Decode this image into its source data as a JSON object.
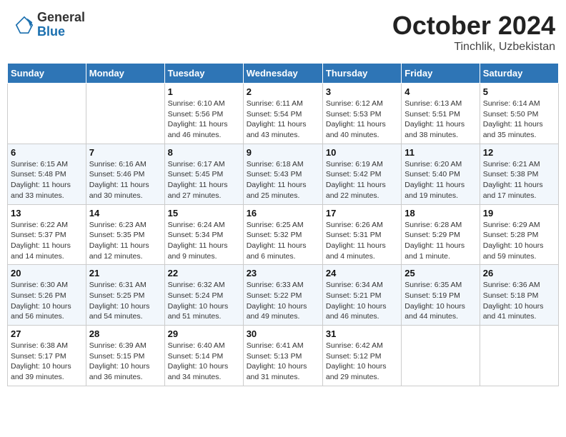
{
  "header": {
    "logo": {
      "general": "General",
      "blue": "Blue"
    },
    "title": "October 2024",
    "subtitle": "Tinchlik, Uzbekistan"
  },
  "weekdays": [
    "Sunday",
    "Monday",
    "Tuesday",
    "Wednesday",
    "Thursday",
    "Friday",
    "Saturday"
  ],
  "weeks": [
    [
      null,
      null,
      {
        "day": "1",
        "sunrise": "6:10 AM",
        "sunset": "5:56 PM",
        "daylight": "11 hours and 46 minutes."
      },
      {
        "day": "2",
        "sunrise": "6:11 AM",
        "sunset": "5:54 PM",
        "daylight": "11 hours and 43 minutes."
      },
      {
        "day": "3",
        "sunrise": "6:12 AM",
        "sunset": "5:53 PM",
        "daylight": "11 hours and 40 minutes."
      },
      {
        "day": "4",
        "sunrise": "6:13 AM",
        "sunset": "5:51 PM",
        "daylight": "11 hours and 38 minutes."
      },
      {
        "day": "5",
        "sunrise": "6:14 AM",
        "sunset": "5:50 PM",
        "daylight": "11 hours and 35 minutes."
      }
    ],
    [
      {
        "day": "6",
        "sunrise": "6:15 AM",
        "sunset": "5:48 PM",
        "daylight": "11 hours and 33 minutes."
      },
      {
        "day": "7",
        "sunrise": "6:16 AM",
        "sunset": "5:46 PM",
        "daylight": "11 hours and 30 minutes."
      },
      {
        "day": "8",
        "sunrise": "6:17 AM",
        "sunset": "5:45 PM",
        "daylight": "11 hours and 27 minutes."
      },
      {
        "day": "9",
        "sunrise": "6:18 AM",
        "sunset": "5:43 PM",
        "daylight": "11 hours and 25 minutes."
      },
      {
        "day": "10",
        "sunrise": "6:19 AM",
        "sunset": "5:42 PM",
        "daylight": "11 hours and 22 minutes."
      },
      {
        "day": "11",
        "sunrise": "6:20 AM",
        "sunset": "5:40 PM",
        "daylight": "11 hours and 19 minutes."
      },
      {
        "day": "12",
        "sunrise": "6:21 AM",
        "sunset": "5:38 PM",
        "daylight": "11 hours and 17 minutes."
      }
    ],
    [
      {
        "day": "13",
        "sunrise": "6:22 AM",
        "sunset": "5:37 PM",
        "daylight": "11 hours and 14 minutes."
      },
      {
        "day": "14",
        "sunrise": "6:23 AM",
        "sunset": "5:35 PM",
        "daylight": "11 hours and 12 minutes."
      },
      {
        "day": "15",
        "sunrise": "6:24 AM",
        "sunset": "5:34 PM",
        "daylight": "11 hours and 9 minutes."
      },
      {
        "day": "16",
        "sunrise": "6:25 AM",
        "sunset": "5:32 PM",
        "daylight": "11 hours and 6 minutes."
      },
      {
        "day": "17",
        "sunrise": "6:26 AM",
        "sunset": "5:31 PM",
        "daylight": "11 hours and 4 minutes."
      },
      {
        "day": "18",
        "sunrise": "6:28 AM",
        "sunset": "5:29 PM",
        "daylight": "11 hours and 1 minute."
      },
      {
        "day": "19",
        "sunrise": "6:29 AM",
        "sunset": "5:28 PM",
        "daylight": "10 hours and 59 minutes."
      }
    ],
    [
      {
        "day": "20",
        "sunrise": "6:30 AM",
        "sunset": "5:26 PM",
        "daylight": "10 hours and 56 minutes."
      },
      {
        "day": "21",
        "sunrise": "6:31 AM",
        "sunset": "5:25 PM",
        "daylight": "10 hours and 54 minutes."
      },
      {
        "day": "22",
        "sunrise": "6:32 AM",
        "sunset": "5:24 PM",
        "daylight": "10 hours and 51 minutes."
      },
      {
        "day": "23",
        "sunrise": "6:33 AM",
        "sunset": "5:22 PM",
        "daylight": "10 hours and 49 minutes."
      },
      {
        "day": "24",
        "sunrise": "6:34 AM",
        "sunset": "5:21 PM",
        "daylight": "10 hours and 46 minutes."
      },
      {
        "day": "25",
        "sunrise": "6:35 AM",
        "sunset": "5:19 PM",
        "daylight": "10 hours and 44 minutes."
      },
      {
        "day": "26",
        "sunrise": "6:36 AM",
        "sunset": "5:18 PM",
        "daylight": "10 hours and 41 minutes."
      }
    ],
    [
      {
        "day": "27",
        "sunrise": "6:38 AM",
        "sunset": "5:17 PM",
        "daylight": "10 hours and 39 minutes."
      },
      {
        "day": "28",
        "sunrise": "6:39 AM",
        "sunset": "5:15 PM",
        "daylight": "10 hours and 36 minutes."
      },
      {
        "day": "29",
        "sunrise": "6:40 AM",
        "sunset": "5:14 PM",
        "daylight": "10 hours and 34 minutes."
      },
      {
        "day": "30",
        "sunrise": "6:41 AM",
        "sunset": "5:13 PM",
        "daylight": "10 hours and 31 minutes."
      },
      {
        "day": "31",
        "sunrise": "6:42 AM",
        "sunset": "5:12 PM",
        "daylight": "10 hours and 29 minutes."
      },
      null,
      null
    ]
  ],
  "labels": {
    "sunrise": "Sunrise:",
    "sunset": "Sunset:",
    "daylight": "Daylight:"
  }
}
